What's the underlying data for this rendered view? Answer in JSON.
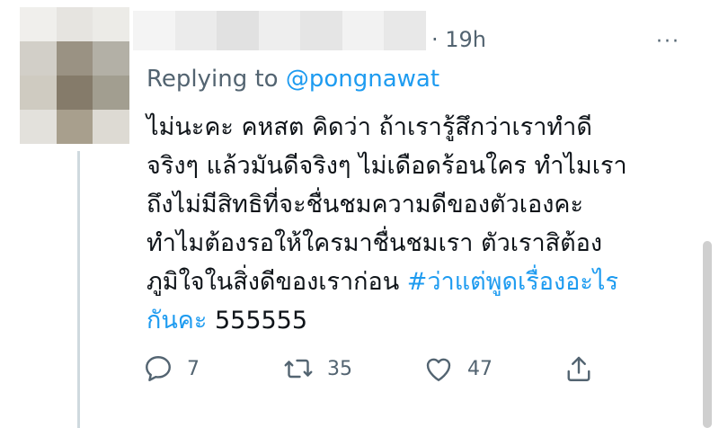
{
  "tweet": {
    "timestamp": "· 19h",
    "more_label": "···",
    "replying_prefix": "Replying to ",
    "replying_handle": "@pongnawat",
    "lines": [
      "ไม่นะคะ คหสต คิดว่า ถ้าเรารู้สึกว่าเราทำดี",
      "จริงๆ แล้วมันดีจริงๆ ไม่เดือดร้อนใคร ทำไมเรา",
      "ถึงไม่มีสิทธิที่จะชื่นชมความดีของตัวเองคะ",
      "ทำไมต้องรอให้ใครมาชื่นชมเรา ตัวเราสิต้อง"
    ],
    "line5_text": "ภูมิใจในสิ่งดีของเราก่อน ",
    "hashtag_part1": "#ว่าแต่พูดเรื่องอะไร",
    "hashtag_part2": "กันคะ",
    "trailing_text": " 555555"
  },
  "actions": {
    "reply_count": "7",
    "retweet_count": "35",
    "like_count": "47"
  },
  "icons": {
    "reply": "reply-bubble-icon",
    "retweet": "retweet-icon",
    "like": "heart-icon",
    "share": "share-upload-icon"
  },
  "colors": {
    "link": "#1d9bf0",
    "secondary_text": "#536471",
    "primary_text": "#0f1419",
    "thread_line": "#cfd9de"
  }
}
